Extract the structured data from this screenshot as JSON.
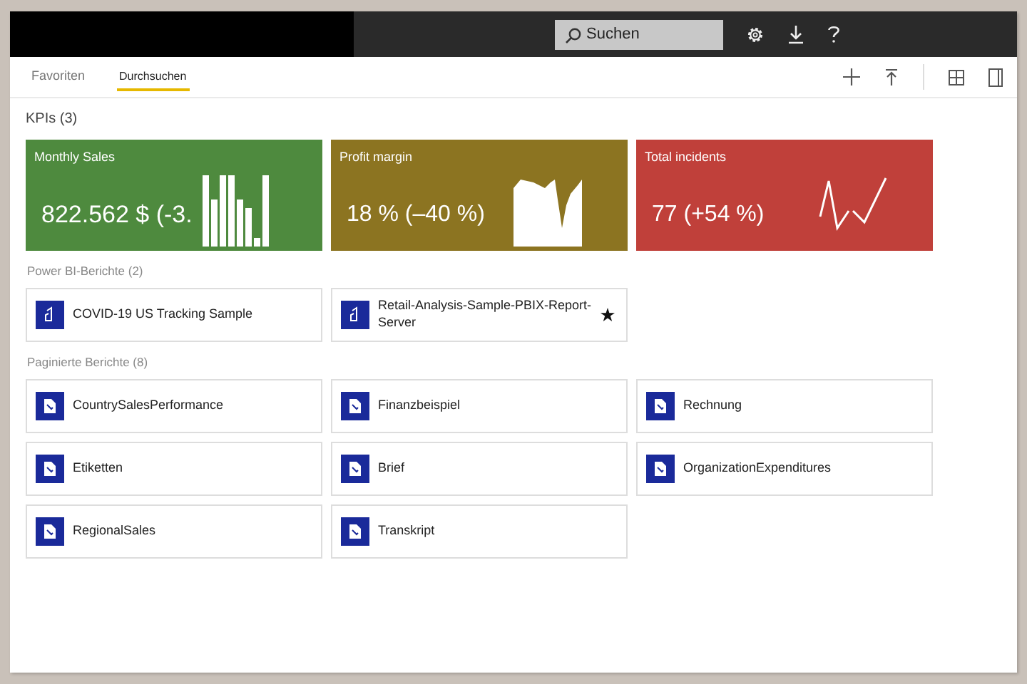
{
  "topbar": {
    "search": {
      "placeholder": "Suchen"
    }
  },
  "tabs": [
    {
      "label": "Favoriten",
      "selected": false
    },
    {
      "label": "Durchsuchen",
      "selected": true
    }
  ],
  "kpis": {
    "heading": "KPIs (3)",
    "tiles": [
      {
        "title": "Monthly Sales",
        "value": "822.562 $ (-3.",
        "color": "#4e8a3e",
        "kind": "bars"
      },
      {
        "title": "Profit margin",
        "value": "18 % (–40 %)",
        "color": "#8c7421",
        "kind": "area"
      },
      {
        "title": "Total incidents",
        "value": "77 (+54 %)",
        "color": "#c0403a",
        "kind": "line"
      }
    ]
  },
  "powerbi_reports": {
    "heading": "Power BI-Berichte (2)",
    "items": [
      {
        "name": "COVID-19 US Tracking Sample",
        "favorite": false
      },
      {
        "name": "Retail-Analysis-Sample-PBIX-Report-Server",
        "favorite": true
      }
    ]
  },
  "paginated_reports": {
    "heading": "Paginierte Berichte (8)",
    "items": [
      {
        "name": "CountrySalesPerformance"
      },
      {
        "name": "Finanzbeispiel"
      },
      {
        "name": "Rechnung"
      },
      {
        "name": "Etiketten"
      },
      {
        "name": "Brief"
      },
      {
        "name": "OrganizationExpenditures"
      },
      {
        "name": "RegionalSales"
      },
      {
        "name": "Transkript"
      }
    ]
  }
}
